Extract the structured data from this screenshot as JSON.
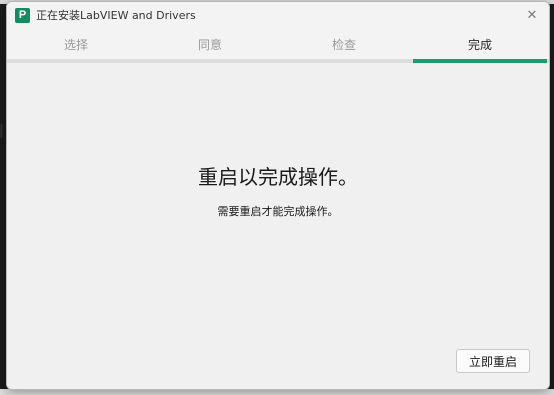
{
  "window": {
    "title": "正在安装LabVIEW and Drivers",
    "app_icon_glyph": "P",
    "close_glyph": "✕"
  },
  "tabs": [
    {
      "label": "选择",
      "active": false
    },
    {
      "label": "同意",
      "active": false
    },
    {
      "label": "检查",
      "active": false
    },
    {
      "label": "完成",
      "active": true
    }
  ],
  "main": {
    "heading": "重启以完成操作。",
    "subtext": "需要重启才能完成操作。",
    "restart_button": "立即重启"
  },
  "colors": {
    "accent": "#1d9c6f",
    "icon_bg": "#148c62"
  }
}
